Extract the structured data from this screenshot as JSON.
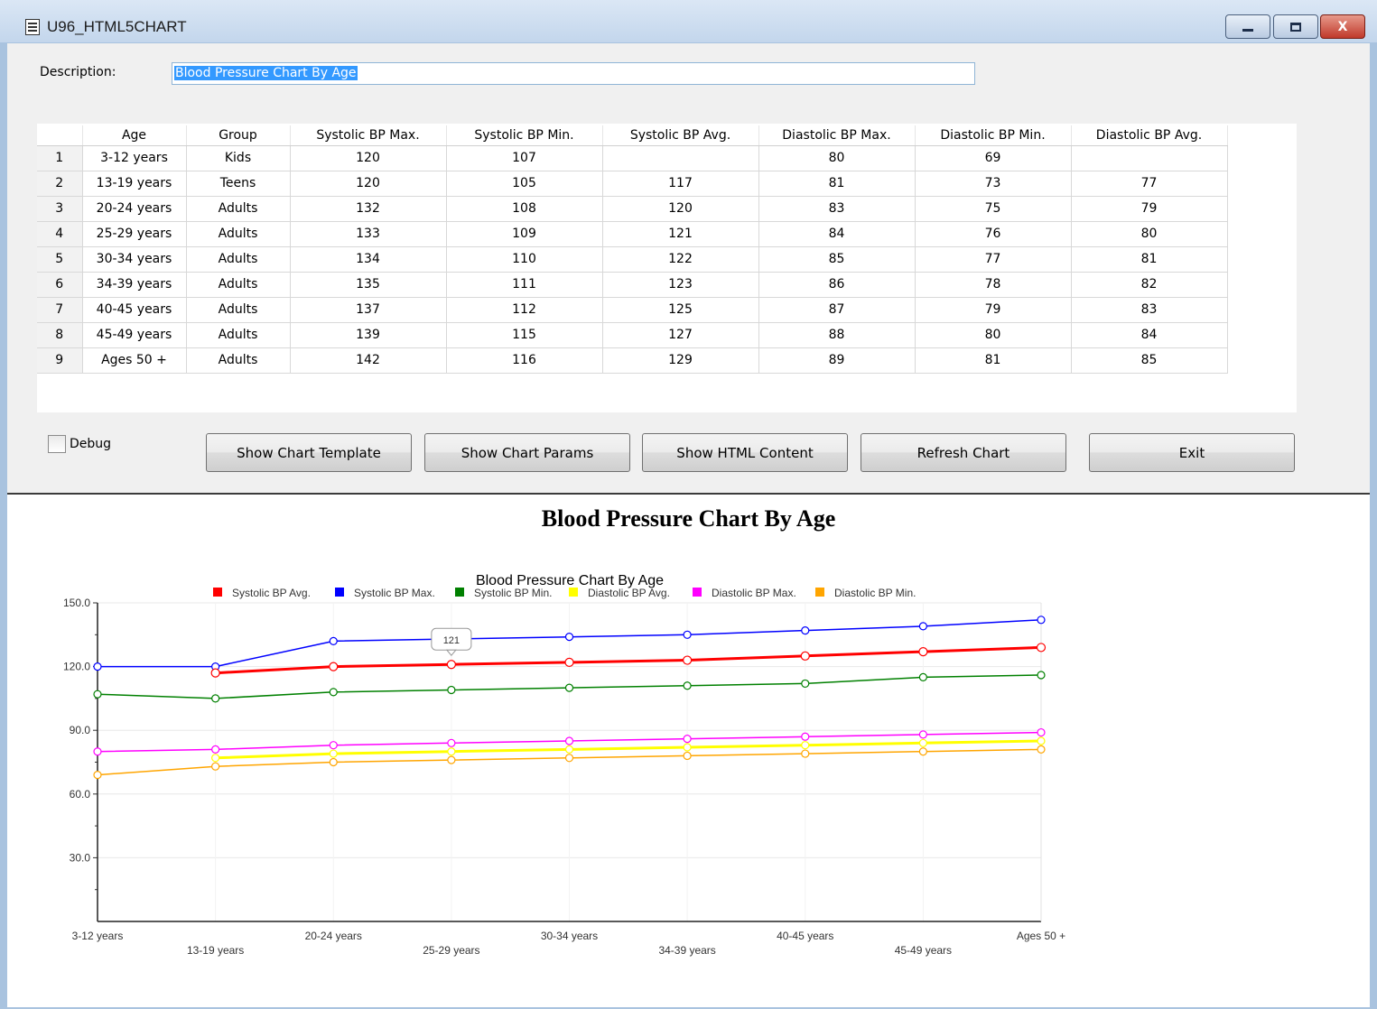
{
  "window": {
    "title": "U96_HTML5CHART",
    "controls": {
      "minimize_icon": "minimize-icon",
      "maximize_icon": "maximize-icon",
      "close_label": "X"
    }
  },
  "description": {
    "label": "Description:",
    "value": "Blood Pressure Chart By Age"
  },
  "grid": {
    "columns": [
      "Age",
      "Group",
      "Systolic BP Max.",
      "Systolic BP Min.",
      "Systolic BP Avg.",
      "Diastolic BP Max.",
      "Diastolic BP Min.",
      "Diastolic BP Avg."
    ],
    "rows": [
      [
        "1",
        "3-12 years",
        "Kids",
        "120",
        "107",
        "",
        "80",
        "69",
        ""
      ],
      [
        "2",
        "13-19 years",
        "Teens",
        "120",
        "105",
        "117",
        "81",
        "73",
        "77"
      ],
      [
        "3",
        "20-24 years",
        "Adults",
        "132",
        "108",
        "120",
        "83",
        "75",
        "79"
      ],
      [
        "4",
        "25-29 years",
        "Adults",
        "133",
        "109",
        "121",
        "84",
        "76",
        "80"
      ],
      [
        "5",
        "30-34 years",
        "Adults",
        "134",
        "110",
        "122",
        "85",
        "77",
        "81"
      ],
      [
        "6",
        "34-39 years",
        "Adults",
        "135",
        "111",
        "123",
        "86",
        "78",
        "82"
      ],
      [
        "7",
        "40-45 years",
        "Adults",
        "137",
        "112",
        "125",
        "87",
        "79",
        "83"
      ],
      [
        "8",
        "45-49 years",
        "Adults",
        "139",
        "115",
        "127",
        "88",
        "80",
        "84"
      ],
      [
        "9",
        "Ages 50 +",
        "Adults",
        "142",
        "116",
        "129",
        "89",
        "81",
        "85"
      ]
    ]
  },
  "controls": {
    "debug_label": "Debug",
    "debug_checked": false,
    "buttons": {
      "show_template": "Show Chart Template",
      "show_params": "Show Chart Params",
      "show_html": "Show HTML Content",
      "refresh": "Refresh Chart",
      "exit": "Exit"
    }
  },
  "chart_heading": "Blood Pressure Chart By Age",
  "chart_data": {
    "type": "line",
    "title": "Blood Pressure Chart By Age",
    "xlabel": "",
    "ylabel": "",
    "categories": [
      "3-12 years",
      "13-19 years",
      "20-24 years",
      "25-29 years",
      "30-34 years",
      "34-39 years",
      "40-45 years",
      "45-49 years",
      "Ages 50 +"
    ],
    "ylim": [
      0,
      150
    ],
    "yticks": [
      "30.0",
      "60.0",
      "90.0",
      "120.0",
      "150.0"
    ],
    "legend_position": "top",
    "grid": true,
    "series": [
      {
        "name": "Systolic BP Avg.",
        "color": "#ff0000",
        "values": [
          null,
          117,
          120,
          121,
          122,
          123,
          125,
          127,
          129
        ]
      },
      {
        "name": "Systolic BP Max.",
        "color": "#0000ff",
        "values": [
          120,
          120,
          132,
          133,
          134,
          135,
          137,
          139,
          142
        ]
      },
      {
        "name": "Systolic BP Min.",
        "color": "#008000",
        "values": [
          107,
          105,
          108,
          109,
          110,
          111,
          112,
          115,
          116
        ]
      },
      {
        "name": "Diastolic BP Avg.",
        "color": "#ffff00",
        "values": [
          null,
          77,
          79,
          80,
          81,
          82,
          83,
          84,
          85
        ]
      },
      {
        "name": "Diastolic BP Max.",
        "color": "#ff00ff",
        "values": [
          80,
          81,
          83,
          84,
          85,
          86,
          87,
          88,
          89
        ]
      },
      {
        "name": "Diastolic BP Min.",
        "color": "#ffa500",
        "values": [
          69,
          73,
          75,
          76,
          77,
          78,
          79,
          80,
          81
        ]
      }
    ],
    "tooltip": {
      "text": "121"
    }
  }
}
